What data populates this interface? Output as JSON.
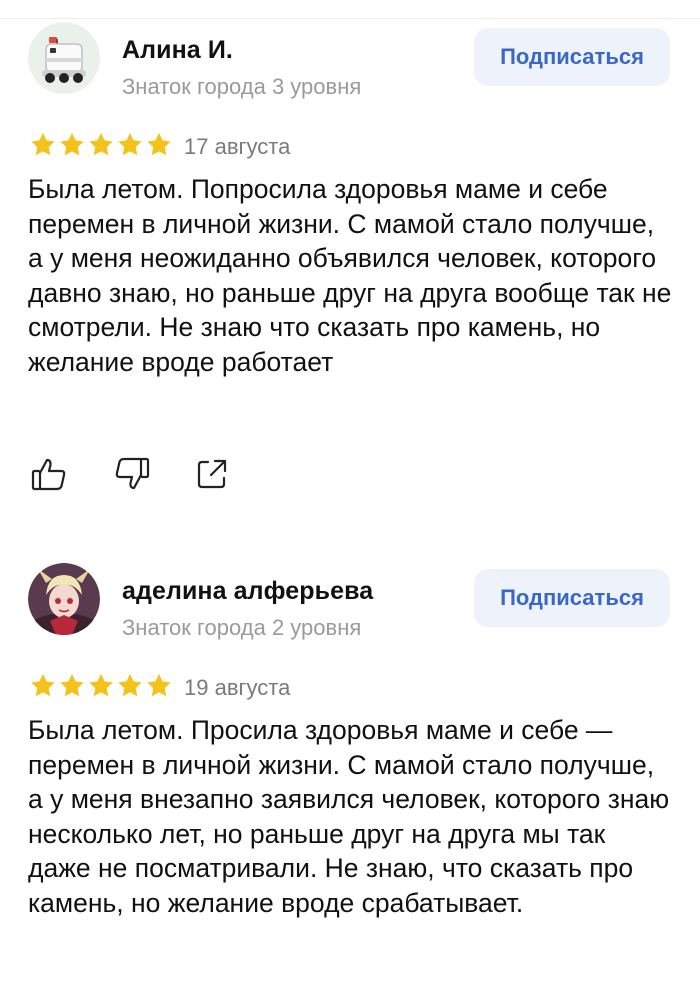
{
  "reviews": [
    {
      "author": "Алина И.",
      "level": "Знаток города 3 уровня",
      "subscribe_label": "Подписаться",
      "rating": 5,
      "date": "17 августа",
      "text": "Была летом. Попросила здоровья маме и себе перемен в личной жизни. С мамой стало получше, а у меня неожиданно объявился человек, которого давно знаю, но раньше друг на друга вообще так не смотрели. Не знаю что сказать про камень, но желание вроде работает",
      "avatar_icon": "delivery-robot-icon"
    },
    {
      "author": "аделина алферьева",
      "level": "Знаток города 2 уровня",
      "subscribe_label": "Подписаться",
      "rating": 5,
      "date": "19 августа",
      "text": "Была летом. Просила здоровья маме и себе — перемен в личной жизни. С мамой стало получше, а у меня внезапно заявился человек, которого знаю несколько лет, но раньше друг на друга мы так даже не посматривали. Не знаю, что сказать про камень, но желание вроде срабатывает.",
      "avatar_icon": "anime-character-avatar"
    }
  ],
  "colors": {
    "star": "#f5c21b",
    "subscribe_text": "#3a67c8",
    "subscribe_bg": "#eef3fb",
    "secondary_text": "#9a9a9a"
  },
  "action_icons": [
    "thumbs-up-icon",
    "thumbs-down-icon",
    "share-icon"
  ]
}
